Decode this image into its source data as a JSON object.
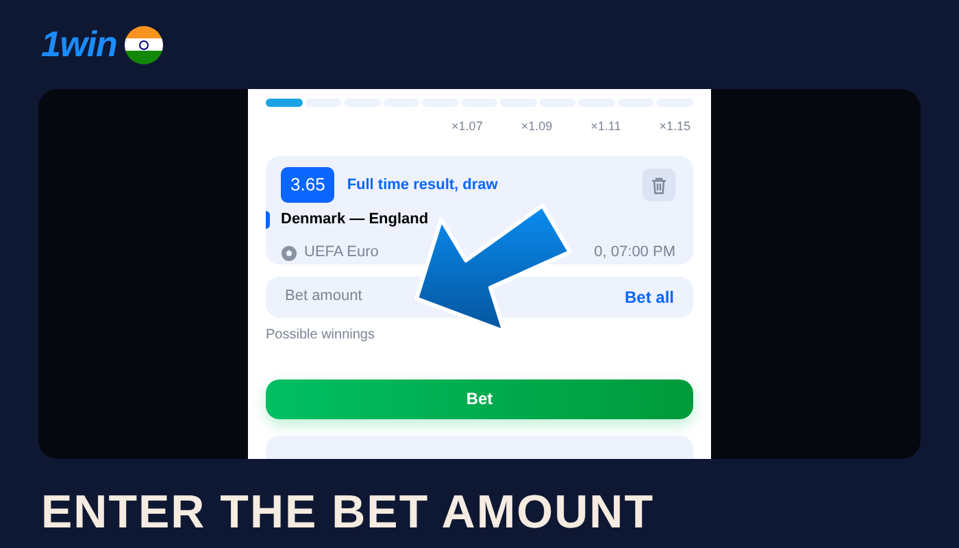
{
  "brand": {
    "logo": "1win"
  },
  "betslip": {
    "progress": {
      "segments": [
        {
          "on": true
        },
        {
          "on": false
        },
        {
          "on": false
        },
        {
          "on": false
        },
        {
          "on": false
        },
        {
          "on": false
        },
        {
          "on": false
        },
        {
          "on": false
        },
        {
          "on": false
        },
        {
          "on": false
        },
        {
          "on": false
        }
      ],
      "multipliers": [
        "×1.07",
        "×1.09",
        "×1.11",
        "×1.15"
      ]
    },
    "bet": {
      "odds": "3.65",
      "market": "Full time result, draw",
      "match": "Denmark — England",
      "tournament": "UEFA Euro",
      "time": "0, 07:00 PM"
    },
    "amount": {
      "placeholder": "Bet amount",
      "action": "Bet all"
    },
    "winnings_label": "Possible winnings",
    "submit": "Bet"
  },
  "heading": "ENTER THE BET AMOUNT"
}
